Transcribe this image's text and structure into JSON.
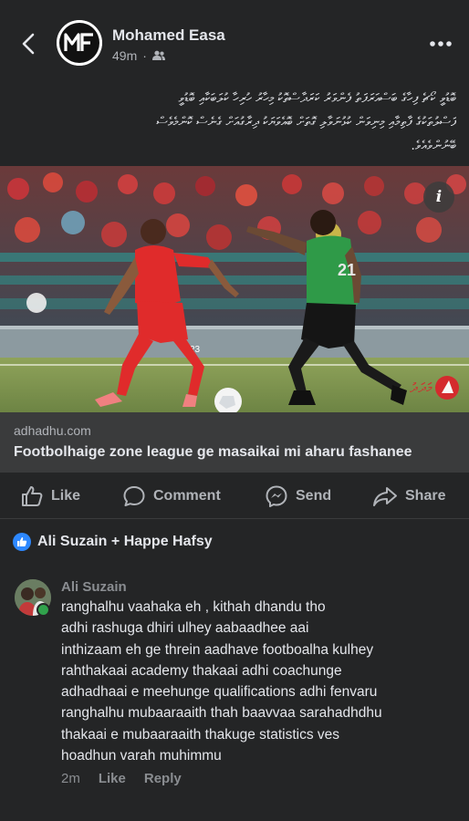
{
  "post": {
    "author": "Mohamed Easa",
    "time": "49m",
    "avatar_logo": "MF",
    "caption": [
      "ބޮޑުވީ ކޯޗެ ފިހާގެ ބަސްއަރަފަތު ފެންވަރު ކަރަދާސްތޮކު މިހާރު ހުރިހާ ކުލަބަކާއި ބޮޑުވީ",
      "ފަސްލުތަކުގެ ފާތިމާއި މިނިވަން ކުޅުނަވާލި ގޮތަށް ބޮއެވަޔަކު ދިރާގުއަށް ގެނެސް ކޮންމެވެސް",
      "ބޭނުންވެއެވެ."
    ],
    "overlay_logo_text": "މަދަދު"
  },
  "link": {
    "domain": "adhadhu.com",
    "title": "Footbolhaige zone league ge masaikai mi aharu fashanee"
  },
  "actions": {
    "like": "Like",
    "comment": "Comment",
    "send": "Send",
    "share": "Share"
  },
  "reactions": {
    "names": "Ali Suzain + Happe Hafsy"
  },
  "comment": {
    "author": "Ali Suzain",
    "lines": [
      "ranghalhu vaahaka eh , kithah dhandu tho",
      "adhi rashuga dhiri ulhey aabaadhee aai",
      "inthizaam eh ge threin aadhave footboalha kulhey",
      "rahthakaai academy thakaai adhi coachunge",
      "adhadhaai e meehunge qualifications adhi fenvaru",
      "ranghalhu mubaaraaith thah baavvaa sarahadhdhu",
      "thakaai e mubaaraaith thakuge statistics ves",
      "hoadhun varah muhimmu"
    ],
    "time": "2m",
    "like": "Like",
    "reply": "Reply"
  },
  "photo": {
    "player_left_number": "23",
    "player_right_number": "21"
  },
  "icons": {
    "back": "back-arrow-icon",
    "audience": "friends-icon",
    "more": "more-dots-icon",
    "info": "info-icon",
    "like": "thumbs-up-icon",
    "comment": "comment-bubble-icon",
    "send": "messenger-icon",
    "share": "share-arrow-icon"
  },
  "colors": {
    "background": "#242526",
    "link_box": "#3a3b3c",
    "accent_blue": "#2d88ff",
    "online_green": "#31a24c",
    "muted": "#b0b3b8"
  }
}
